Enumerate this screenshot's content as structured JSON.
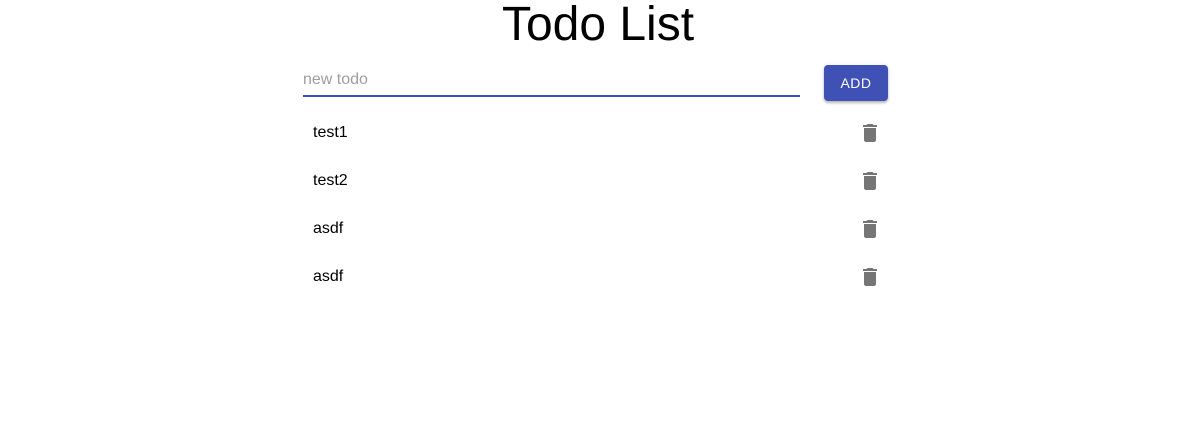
{
  "page": {
    "title": "Todo List"
  },
  "form": {
    "input_value": "",
    "input_placeholder": "new todo",
    "add_label": "ADD"
  },
  "todos": [
    {
      "text": "test1",
      "delete_icon": "trash-icon"
    },
    {
      "text": "test2",
      "delete_icon": "trash-icon"
    },
    {
      "text": "asdf",
      "delete_icon": "trash-icon"
    },
    {
      "text": "asdf",
      "delete_icon": "trash-icon"
    }
  ],
  "colors": {
    "accent": "#3f51b5",
    "icon": "#757575",
    "placeholder": "#9e9e9e"
  }
}
